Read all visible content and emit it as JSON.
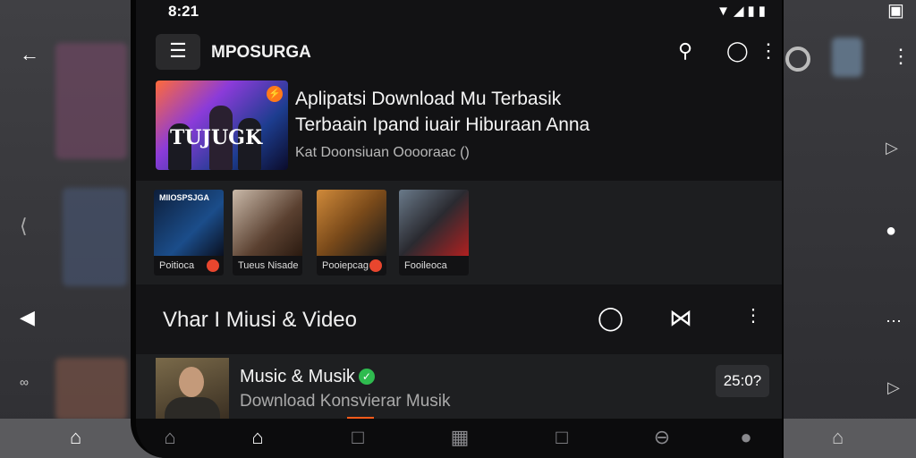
{
  "status": {
    "time": "8:21",
    "icons": "▼◢▮▮"
  },
  "app": {
    "title": "MPOSURGA"
  },
  "featured": {
    "poster_title": "TUJUGK",
    "line1": "Aplipatsi Download Mu Terbasik",
    "line2": "Terbaain Ipand iuair Hiburaan Anna",
    "line3": "Kat Doonsiuan Ooooraac ()"
  },
  "thumbs": [
    {
      "tag": "MIIOSPSJGA",
      "caption": "Poitioca"
    },
    {
      "tag": "",
      "caption": "Tueus Nisade"
    },
    {
      "tag": "",
      "caption": "Pooiepcag"
    },
    {
      "tag": "",
      "caption": "Fooileoca"
    }
  ],
  "section": {
    "title": "Vhar I Miusi & Video"
  },
  "list_item": {
    "title": "Music & Musik",
    "subtitle": "Download Konsvierar Musik",
    "duration": "25:0?"
  },
  "icons": {
    "back": "back-arrow-icon",
    "menu": "hamburger-icon",
    "search": "search-icon",
    "chat": "chat-search-icon",
    "more": "more-vertical-icon"
  }
}
